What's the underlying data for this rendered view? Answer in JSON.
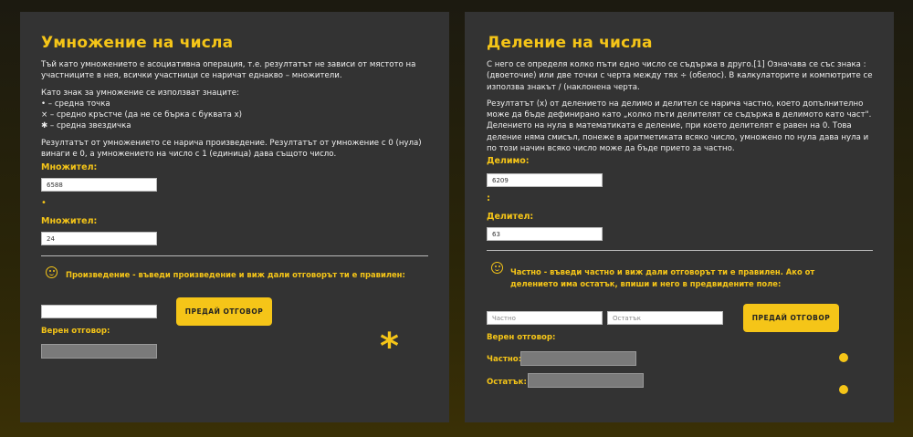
{
  "multiplication": {
    "title": "Умножение на числа",
    "paragraph1": "Тъй като умножението е асоциативна операция, т.е. резултатът не зависи от мястото на участниците в нея, всички участници се наричат еднакво – множители.",
    "signs_intro": "Като знак за умножение се използват знаците:",
    "sign1": "• – средна точка",
    "sign2": "× – средно кръстче (да не се бърка с буквата x)",
    "sign3": "✱ – средна звездичка",
    "paragraph2": "Резултатът от умножението се нарича произведение. Резултатът от умножение с 0 (нула) винаги е 0, а умножението на число с 1 (единица) дава същото число.",
    "factor1_label": "Множител:",
    "factor1_value": "6588",
    "operator_symbol": "•",
    "factor2_label": "Множител:",
    "factor2_value": "24",
    "prompt": "Произведение - въведи произведение и виж дали отговорът ти е правилен:",
    "answer_value": "",
    "submit_label": "ПРЕДАЙ ОТГОВОР",
    "correct_label": "Верен отговор:",
    "decor_symbol": "*"
  },
  "division": {
    "title": "Деление на числа",
    "paragraph1": "С него се определя колко пъти едно число се съдържа в друго.[1] Означава се със знака : (двоеточие) или две точки с черта между тях ÷ (обелос). В калкулаторите и компютрите се използва знакът / (наклонена черта.",
    "paragraph2": "Резултатът (x) от делението на делимо и делител се нарича частно, което допълнително може да бъде дефинирано като „колко пъти делителят се съдържа в делимото като част\". Делението на нула в математиката е деление, при което делителят е равен на 0. Това деление няма смисъл, понеже в аритметиката всяко число, умножено по нула дава нула и по този начин всяко число може да бъде прието за частно.",
    "dividend_label": "Делимо:",
    "dividend_value": "6209",
    "operator_symbol": ":",
    "divisor_label": "Делител:",
    "divisor_value": "63",
    "prompt": "Частно - въведи частно и виж дали отговорът ти е правилен. Ако от делението има остатък, впиши и него в предвидените поле:",
    "quotient_placeholder": "Частно",
    "remainder_placeholder": "Остатък",
    "submit_label": "ПРЕДАЙ ОТГОВОР",
    "correct_label": "Верен отговор:",
    "quotient_label": "Частно:",
    "remainder_label": "Остатък:"
  },
  "colors": {
    "accent": "#f5c518",
    "panel": "#333333"
  }
}
